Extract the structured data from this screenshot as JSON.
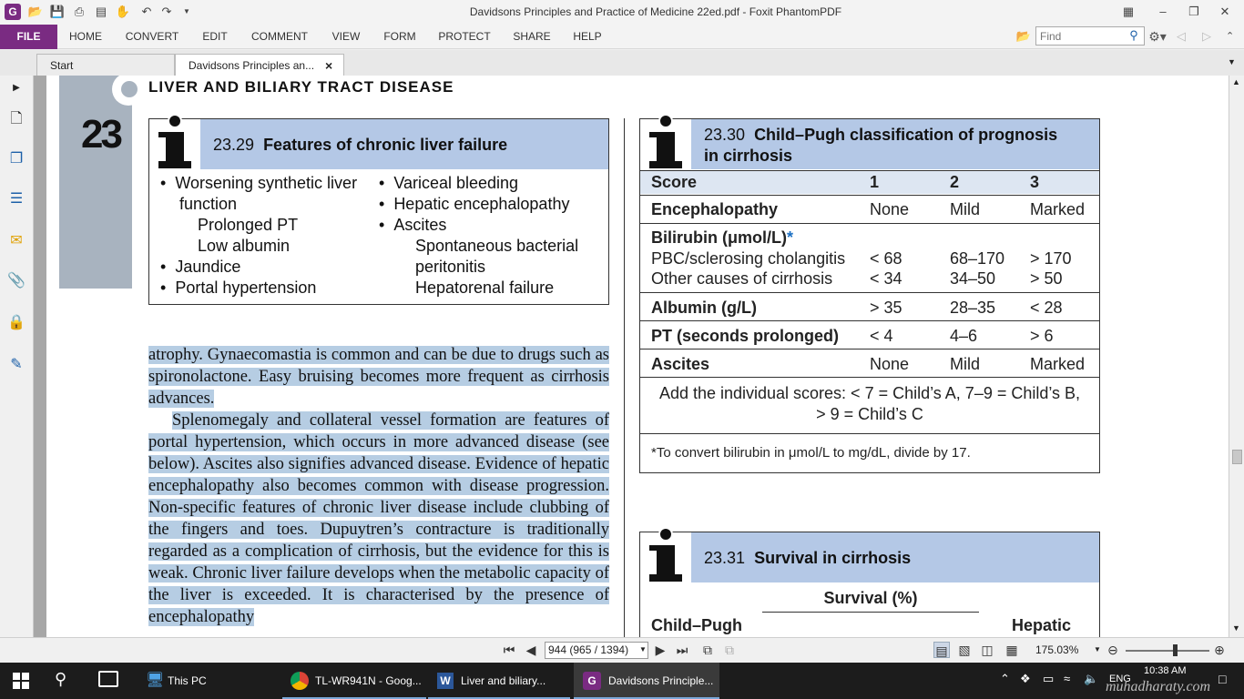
{
  "window": {
    "title": "Davidsons Principles and Practice of Medicine 22ed.pdf - Foxit PhantomPDF"
  },
  "menu": {
    "file": "FILE",
    "items": [
      "HOME",
      "CONVERT",
      "EDIT",
      "COMMENT",
      "VIEW",
      "FORM",
      "PROTECT",
      "SHARE",
      "HELP"
    ],
    "find_placeholder": "Find"
  },
  "tabs": [
    {
      "label": "Start"
    },
    {
      "label": "Davidsons Principles an...",
      "close": "×"
    }
  ],
  "page": {
    "chapter_number": "23",
    "section_title": "LIVER AND BILIARY TRACT DISEASE",
    "box1": {
      "number": "23.29",
      "title": "Features of chronic liver failure",
      "left_items": [
        "Worsening synthetic liver",
        "function",
        "Prolonged PT",
        "Low albumin",
        "Jaundice",
        "Portal hypertension"
      ],
      "right_items": [
        "Variceal bleeding",
        "Hepatic encephalopathy",
        "Ascites",
        "Spontaneous bacterial",
        "peritonitis",
        "Hepatorenal failure"
      ]
    },
    "body_text": {
      "p1": "atrophy. Gynaecomastia is common and can be due to drugs such as spironolactone. Easy bruising becomes more frequent as cirrhosis advances.",
      "p2": "Splenomegaly and collateral vessel formation are features of portal hypertension, which occurs in more advanced disease (see below). Ascites also signifies advanced disease. Evidence of hepatic encephalopathy also becomes common with disease progression. Non-specific features of chronic liver disease include clubbing of the fingers and toes. Dupuytren’s contracture is traditionally regarded as a complication of cirrhosis, but the evidence for this is weak. Chronic liver failure develops when the metabolic capacity of the liver is exceeded. It is characterised by the presence of encephalopathy"
    },
    "box2": {
      "number": "23.30",
      "title_line1": "Child–Pugh classification of prognosis",
      "title_line2": "in cirrhosis",
      "header": [
        "Score",
        "1",
        "2",
        "3"
      ],
      "rows": [
        {
          "label": "Encephalopathy",
          "v": [
            "None",
            "Mild",
            "Marked"
          ]
        },
        {
          "label": "Bilirubin (μmol/L)",
          "star": "*"
        },
        {
          "label": "PBC/sclerosing cholangitis",
          "v": [
            "< 68",
            "68–170",
            "> 170"
          ]
        },
        {
          "label": "Other causes of cirrhosis",
          "v": [
            "< 34",
            "34–50",
            "> 50"
          ]
        },
        {
          "label": "Albumin (g/L)",
          "v": [
            "> 35",
            "28–35",
            "< 28"
          ]
        },
        {
          "label": "PT (seconds prolonged)",
          "v": [
            "< 4",
            "4–6",
            "> 6"
          ]
        },
        {
          "label": "Ascites",
          "v": [
            "None",
            "Mild",
            "Marked"
          ]
        }
      ],
      "sum_line1": "Add the individual scores: < 7 = Child’s A, 7–9 = Child’s B,",
      "sum_line2": "> 9 = Child’s C",
      "footnote": "*To convert bilirubin in μmol/L to mg/dL, divide by 17."
    },
    "box3": {
      "number": "23.31",
      "title": "Survival in cirrhosis",
      "survival": "Survival (%)",
      "col1": "Child–Pugh",
      "col2": "Hepatic"
    }
  },
  "status": {
    "page_field": "944 (965 / 1394)",
    "zoom": "175.03%"
  },
  "taskbar": {
    "items": [
      "This PC",
      "TL-WR941N - Goog...",
      "Liver    and biliary...",
      "Davidsons Principle..."
    ],
    "lang": "ENG",
    "time": "10:38 AM",
    "watermark": "muhadharaty.com"
  },
  "colors": {
    "accent": "#7a2b82",
    "box_head": "#b4c8e6",
    "highlight": "#b6cde3"
  }
}
